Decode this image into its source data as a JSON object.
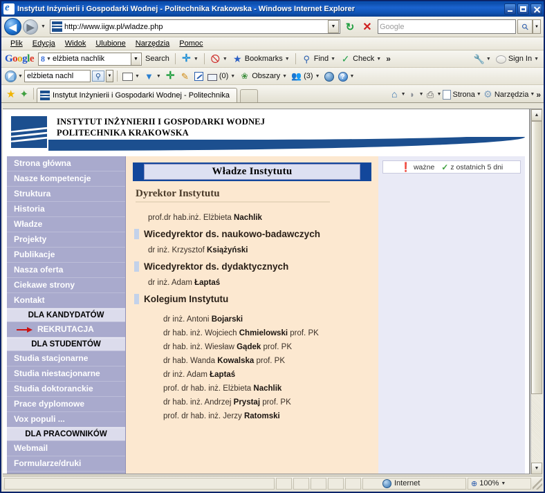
{
  "window": {
    "title": "Instytut Inżynierii i Gospodarki Wodnej - Politechnika Krakowska - Windows Internet Explorer",
    "minimize_label": "Minimize",
    "maximize_label": "Maximize",
    "close_label": "Close"
  },
  "navbar": {
    "back_label": "◀",
    "forward_label": "▶",
    "history_caret": "▼",
    "url": "http://www.iigw.pl/wladze.php",
    "url_dropdown_caret": "▼",
    "refresh_label": "↻",
    "stop_label": "✕",
    "search_placeholder": "Google",
    "search_value": "",
    "search_go_icon": "magnifier-icon",
    "search_options_caret": "▼"
  },
  "menubar": {
    "items": [
      "Plik",
      "Edycja",
      "Widok",
      "Ulubione",
      "Narzędzia",
      "Pomoc"
    ]
  },
  "google_toolbar": {
    "logo": [
      "G",
      "o",
      "o",
      "g",
      "l",
      "e"
    ],
    "query_value": "elżbieta nachlik",
    "query_caret": "▼",
    "search_label": "Search",
    "plus_caret": "▼",
    "red_caret": "▼",
    "bookmarks_label": "Bookmarks",
    "bookmarks_caret": "▼",
    "find_label": "Find",
    "find_caret": "▼",
    "check_label": "Check",
    "check_caret": "▼",
    "overflow_label": "»",
    "wrench_caret": "▼",
    "signin_label": "Sign In",
    "signin_caret": "▼"
  },
  "toolbar2": {
    "logo_caret": "▼",
    "search_value": "elżbieta nachl",
    "search_caret": "▼",
    "card_caret": "▼",
    "bird_caret": "▼",
    "mail_count": "(0)",
    "mail_caret": "▼",
    "obszary_label": "Obszary",
    "obszary_caret": "▼",
    "contacts_count": "(3)",
    "contacts_caret": "▼",
    "globe_caret": "▼",
    "help_caret": "▼",
    "help_glyph": "?"
  },
  "tabbar": {
    "favorites_star": "★",
    "add_favorite": "✦",
    "tab_title": "Instytut Inżynierii i Gospodarki Wodnej - Politechnika ...",
    "home_caret": "▼",
    "rss_caret": "▼",
    "print_caret": "▼",
    "page_label": "Strona",
    "page_caret": "▼",
    "tools_label": "Narzędzia",
    "tools_caret": "▼",
    "overflow": "»"
  },
  "site": {
    "header": {
      "line1": "INSTYTUT INŻYNIERII I GOSPODARKI WODNEJ",
      "line2": "POLITECHNIKA KRAKOWSKA"
    },
    "sidebar": [
      {
        "type": "link",
        "label": "Strona główna"
      },
      {
        "type": "link",
        "label": "Nasze kompetencje"
      },
      {
        "type": "link",
        "label": "Struktura"
      },
      {
        "type": "link",
        "label": "Historia"
      },
      {
        "type": "link",
        "label": "Władze"
      },
      {
        "type": "link",
        "label": "Projekty"
      },
      {
        "type": "link",
        "label": "Publikacje"
      },
      {
        "type": "link",
        "label": "Nasza oferta"
      },
      {
        "type": "link",
        "label": "Ciekawe strony"
      },
      {
        "type": "link",
        "label": "Kontakt"
      },
      {
        "type": "head",
        "label": "DLA KANDYDATÓW"
      },
      {
        "type": "rekrutacja",
        "label": "REKRUTACJA"
      },
      {
        "type": "head",
        "label": "DLA STUDENTÓW"
      },
      {
        "type": "link",
        "label": "Studia stacjonarne"
      },
      {
        "type": "link2",
        "label": "Studia niestacjonarne"
      },
      {
        "type": "link",
        "label": "Studia doktoranckie"
      },
      {
        "type": "link",
        "label": "Prace dyplomowe"
      },
      {
        "type": "link",
        "label": "Vox populi ..."
      },
      {
        "type": "head",
        "label": "DLA PRACOWNIKÓW"
      },
      {
        "type": "link",
        "label": "Webmail"
      },
      {
        "type": "link",
        "label": "Formularze/druki"
      }
    ],
    "content": {
      "page_title": "Władze Instytutu",
      "dyrektor_heading": "Dyrektor Instytutu",
      "dyrektor_person_prefix": "prof.dr hab.inż. Elżbieta ",
      "dyrektor_person_name": "Nachlik",
      "wice_nauk_heading": "Wicedyrektor ds. naukowo-badawczych",
      "wice_nauk_prefix": "dr inż. Krzysztof ",
      "wice_nauk_name": "Książyński",
      "wice_dyd_heading": "Wicedyrektor ds. dydaktycznych",
      "wice_dyd_prefix": "dr inż. Adam ",
      "wice_dyd_name": "Łaptaś",
      "kolegium_heading": "Kolegium Instytutu",
      "kolegium": [
        {
          "prefix": "dr inż. Antoni ",
          "name": "Bojarski",
          "suffix": ""
        },
        {
          "prefix": "dr hab. inż. Wojciech ",
          "name": "Chmielowski",
          "suffix": " prof. PK"
        },
        {
          "prefix": "dr hab. inż. Wiesław ",
          "name": "Gądek",
          "suffix": " prof. PK"
        },
        {
          "prefix": "dr hab. Wanda ",
          "name": "Kowalska",
          "suffix": " prof. PK"
        },
        {
          "prefix": "dr inż. Adam ",
          "name": "Łaptaś",
          "suffix": ""
        },
        {
          "prefix": "prof. dr hab. inż. Elżbieta ",
          "name": "Nachlik",
          "suffix": ""
        },
        {
          "prefix": "dr hab. inż. Andrzej ",
          "name": "Prystaj",
          "suffix": " prof. PK"
        },
        {
          "prefix": "prof. dr hab. inż. Jerzy ",
          "name": "Ratomski",
          "suffix": ""
        }
      ]
    },
    "rightpanel": {
      "legend_important": "ważne",
      "legend_recent": "z ostatnich 5 dni"
    }
  },
  "scrollbar": {
    "up_arrow": "▲",
    "down_arrow": "▼"
  },
  "statusbar": {
    "message": "",
    "zone": "Internet",
    "zoom": "100%",
    "zoom_caret": "▼"
  }
}
